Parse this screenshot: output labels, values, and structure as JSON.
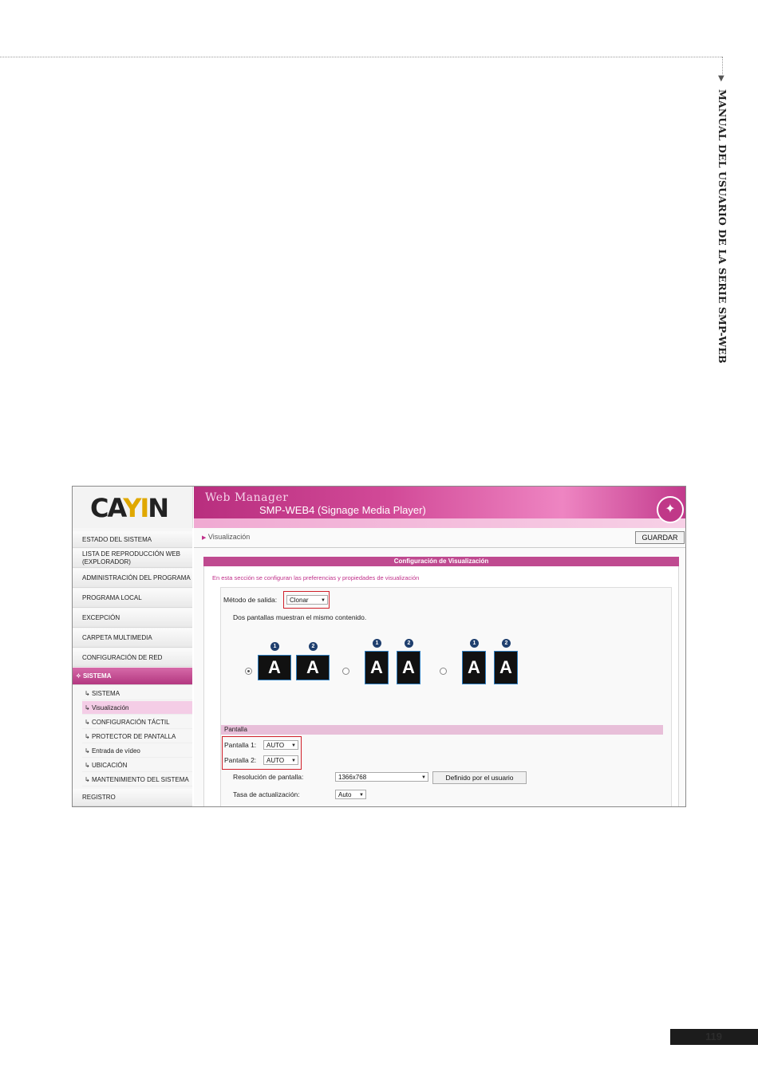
{
  "page": {
    "side_title": "MANUAL DEL USUARIO DE LA SERIE SMP-WEB",
    "page_number": "119"
  },
  "screenshot": {
    "logo": "CAYIN",
    "header": {
      "title": "Web Manager",
      "subtitle": "SMP-WEB4 (Signage Media Player)"
    },
    "menu": [
      "ESTADO DEL SISTEMA",
      "LISTA DE REPRODUCCIÓN WEB (EXPLORADOR)",
      "ADMINISTRACIÓN DEL PROGRAMA",
      "PROGRAMA LOCAL",
      "EXCEPCIÓN",
      "CARPETA MULTIMEDIA",
      "CONFIGURACIÓN DE RED",
      "SISTEMA",
      "REGISTRO"
    ],
    "submenu": [
      "SISTEMA",
      "Visualización",
      "CONFIGURACIÓN TÁCTIL",
      "PROTECTOR DE PANTALLA",
      "Entrada de vídeo",
      "UBICACIÓN",
      "MANTENIMIENTO DEL SISTEMA"
    ],
    "breadcrumb": "Visualización",
    "save_label": "GUARDAR",
    "panel_title": "Configuración de Visualización",
    "intro": "En esta sección se configuran las preferencias y propiedades de visualización",
    "output_method_label": "Método de salida:",
    "output_method_value": "Clonar",
    "output_description": "Dos pantallas muestran el mismo contenido.",
    "monitor_letter": "A",
    "monitor_numbers": [
      "1",
      "2"
    ],
    "pantalla_section": "Pantalla",
    "pantalla1_label": "Pantalla 1:",
    "pantalla1_value": "AUTO",
    "pantalla2_label": "Pantalla 2:",
    "pantalla2_value": "AUTO",
    "resolution_label": "Resolución de pantalla:",
    "resolution_value": "1366x768",
    "user_defined_button": "Definido por el usuario",
    "refresh_label": "Tasa de actualización:",
    "refresh_value": "Auto"
  }
}
